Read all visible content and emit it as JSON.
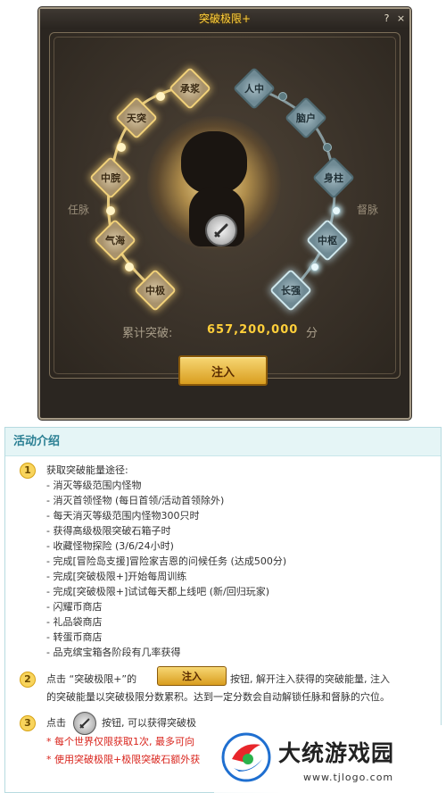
{
  "window": {
    "title": "突破极限+",
    "help_label": "?",
    "close_label": "×"
  },
  "meridians": {
    "left_label": "任脉",
    "right_label": "督脉",
    "left_nodes": [
      {
        "label": "承浆",
        "state": "lit"
      },
      {
        "label": "天突",
        "state": "lit"
      },
      {
        "label": "中脘",
        "state": "lit"
      },
      {
        "label": "气海",
        "state": "lit"
      },
      {
        "label": "中极",
        "state": "lit"
      }
    ],
    "right_nodes": [
      {
        "label": "人中",
        "state": "unlit"
      },
      {
        "label": "脑户",
        "state": "unlit"
      },
      {
        "label": "身柱",
        "state": "unlit"
      },
      {
        "label": "中枢",
        "state": "lit"
      },
      {
        "label": "长强",
        "state": "lit"
      }
    ]
  },
  "accumulated": {
    "label": "累计突破:",
    "value": "657,200,000",
    "unit": "分"
  },
  "inject_button": "注入",
  "colors": {
    "gold_accent": "#ffcf3a",
    "panel_bg": "#2b2621",
    "teal_header": "#2a7f93",
    "red_note": "#d9241c"
  },
  "activity": {
    "title": "活动介绍",
    "step1": {
      "num": "1",
      "heading": "获取突破能量途径:",
      "items": [
        "- 消灭等级范围内怪物",
        "- 消灭首领怪物 (每日首领/活动首领除外)",
        "- 每天消灭等级范围内怪物300只时",
        "- 获得高级极限突破石箱子时",
        "- 收藏怪物探险 (3/6/24小时)",
        "- 完成[冒险岛支援]冒险家吉恩的问候任务 (达成500分)",
        "- 完成[突破极限+]开始每周训练",
        "- 完成[突破极限+]试试每天都上线吧 (新/回归玩家)",
        "- 闪耀币商店",
        "- 礼品袋商店",
        "- 转蛋币商店",
        "- 品克缤宝箱各阶段有几率获得"
      ]
    },
    "step2": {
      "num": "2",
      "prefix": "点击 “突破极限+”的",
      "button": "注入",
      "suffix": "按钮, 解开注入获得的突破能量, 注入",
      "line2": "的突破能量以突破极限分数累积。达到一定分数会自动解锁任脉和督脉的穴位。"
    },
    "step3": {
      "num": "3",
      "prefix": "点击",
      "suffix": "按钮, 可以获得突破极",
      "note1": "* 每个世界仅限获取1次, 最多可向",
      "note2": "* 使用突破极限+极限突破石额外获"
    }
  },
  "watermark": {
    "title": "大统游戏园",
    "url": "www.tjlogo.com"
  }
}
